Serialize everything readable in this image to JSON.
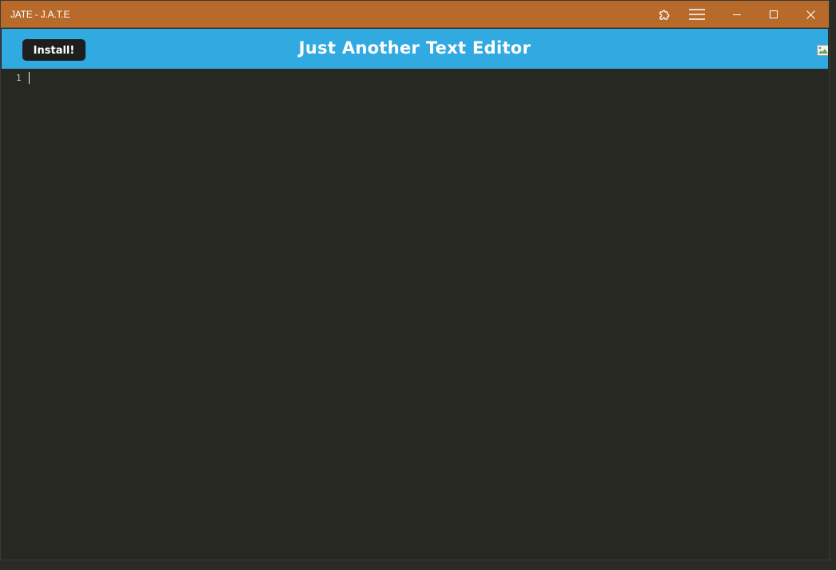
{
  "window": {
    "title": "JATE - J.A.T.E",
    "controls": {
      "extensions_icon": "puzzle-icon",
      "menu_icon": "hamburger-menu-icon",
      "minimize_icon": "minimize-icon",
      "maximize_icon": "maximize-icon",
      "close_icon": "close-icon"
    }
  },
  "header": {
    "install_label": "Install!",
    "title": "Just Another Text Editor",
    "logo_icon": "broken-image-icon"
  },
  "editor": {
    "line_numbers": [
      "1"
    ],
    "content": ""
  },
  "colors": {
    "titlebar": "#b86a2b",
    "header": "#31a9e1",
    "editor_bg": "#272822",
    "install_bg": "#1e1e1e"
  }
}
